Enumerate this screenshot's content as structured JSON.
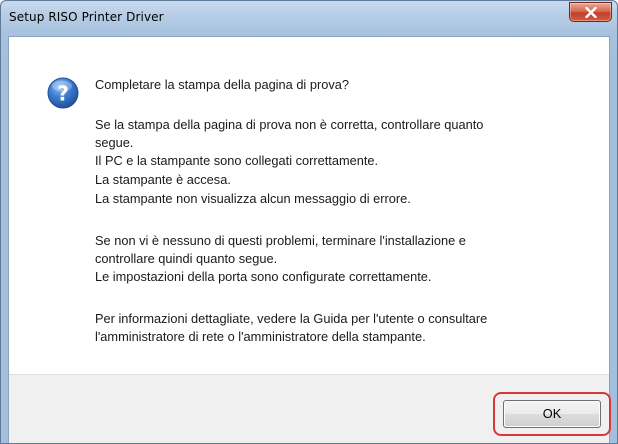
{
  "window": {
    "title": "Setup RISO Printer Driver"
  },
  "dialog": {
    "icon": "question-icon",
    "heading": "Completare la stampa della pagina di prova?",
    "paragraph1": {
      "line1": "Se la stampa della pagina di prova non è corretta, controllare quanto",
      "line2": "segue.",
      "items": [
        " Il PC e la stampante sono collegati correttamente.",
        " La stampante è accesa.",
        " La stampante non visualizza alcun messaggio di errore."
      ]
    },
    "paragraph2": {
      "line1": "Se non vi è nessuno di questi problemi, terminare l'installazione e",
      "line2": "controllare quindi quanto segue.",
      "items": [
        " Le impostazioni della porta sono configurate correttamente."
      ]
    },
    "paragraph3": {
      "line1": "Per informazioni dettagliate, vedere la Guida per l'utente o consultare",
      "line2": "l'amministratore di rete o l'amministratore della stampante."
    }
  },
  "buttons": {
    "ok_label": "OK"
  },
  "colors": {
    "highlight": "#d6383a",
    "close_button": "#c2402a",
    "icon_blue": "#2a5fb0"
  }
}
